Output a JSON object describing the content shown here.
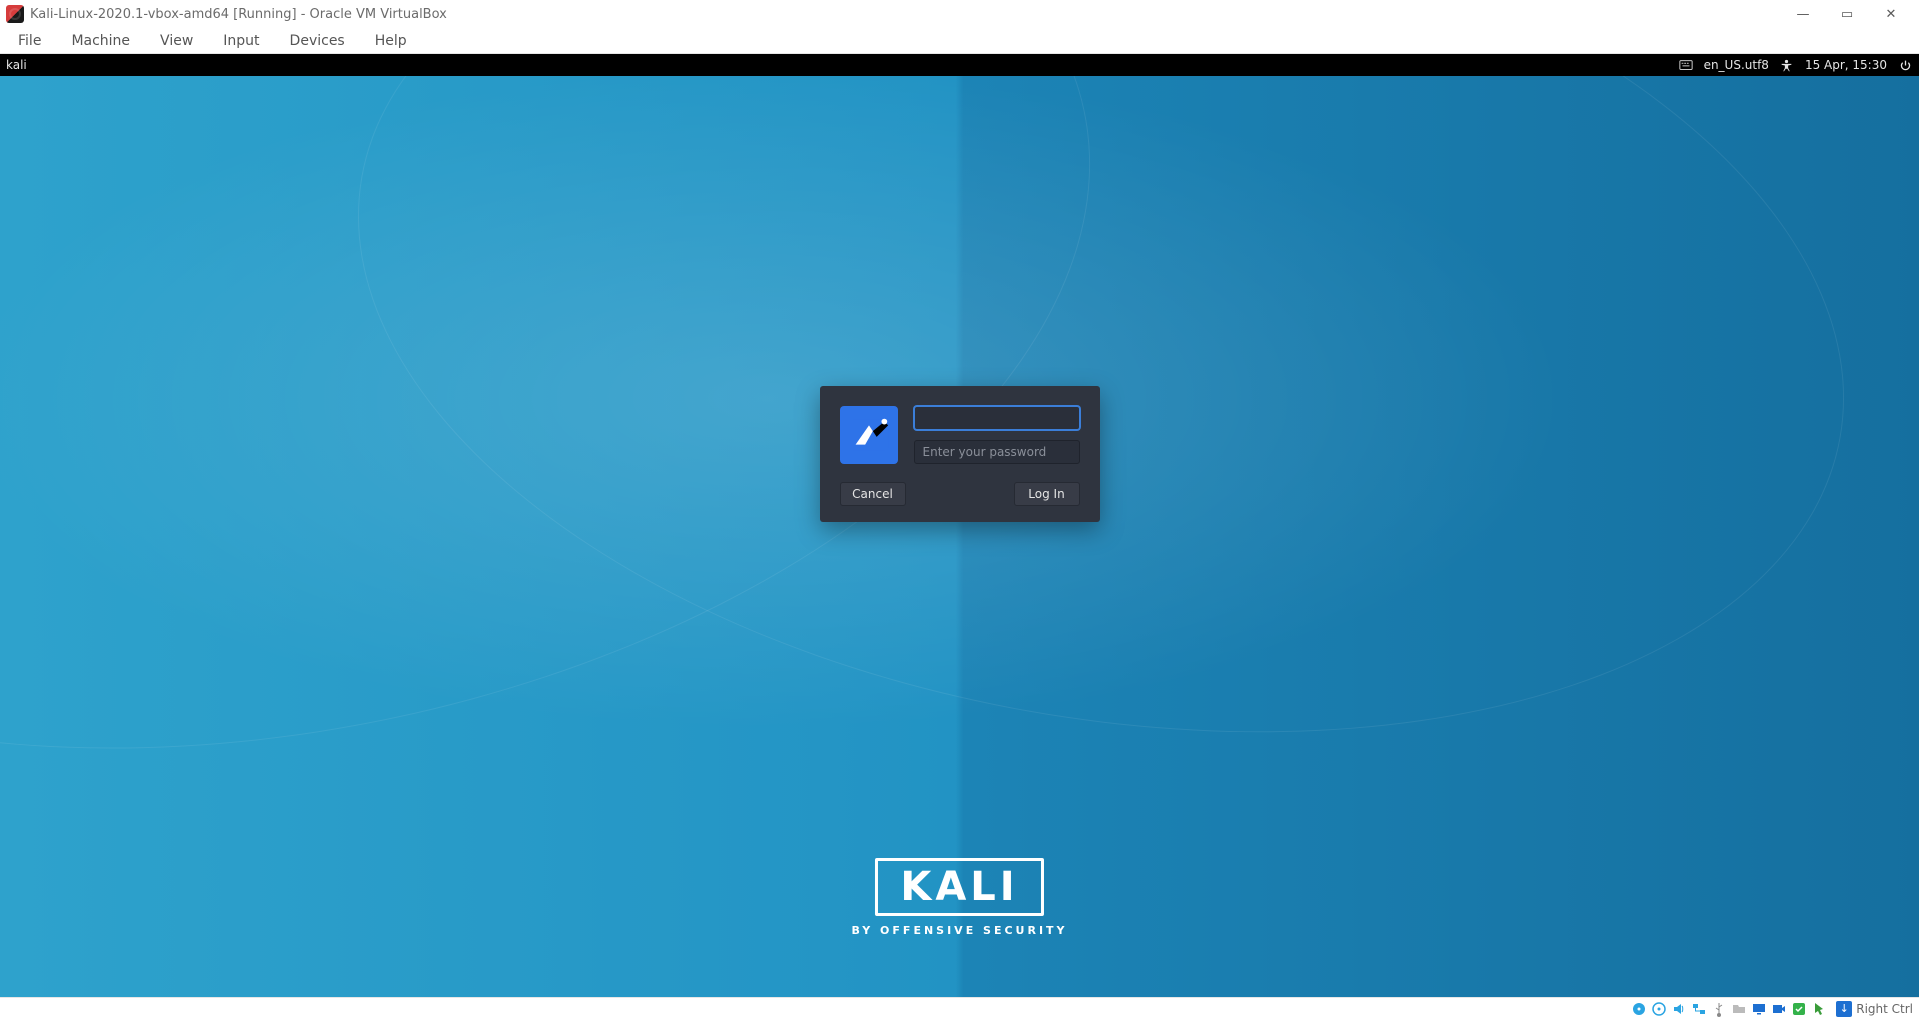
{
  "host_window": {
    "title": "Kali-Linux-2020.1-vbox-amd64 [Running] - Oracle VM VirtualBox",
    "controls": {
      "minimize": "—",
      "maximize": "▭",
      "close": "✕"
    }
  },
  "host_menu": {
    "file": "File",
    "machine": "Machine",
    "view": "View",
    "input": "Input",
    "devices": "Devices",
    "help": "Help"
  },
  "guest_panel": {
    "user": "kali",
    "locale": "en_US.utf8",
    "datetime": "15 Apr, 15:30"
  },
  "login": {
    "username_value": "",
    "password_value": "",
    "password_placeholder": "Enter your password",
    "cancel_label": "Cancel",
    "login_label": "Log In"
  },
  "branding": {
    "logo_text": "KALI",
    "tagline": "BY OFFENSIVE SECURITY"
  },
  "statusbar": {
    "hostkey_label": "Right Ctrl"
  },
  "colors": {
    "accent": "#3b7ed8",
    "dialog_bg": "#2f343f",
    "desktop_left": "#2ea2cc",
    "desktop_right": "#156f9f"
  }
}
